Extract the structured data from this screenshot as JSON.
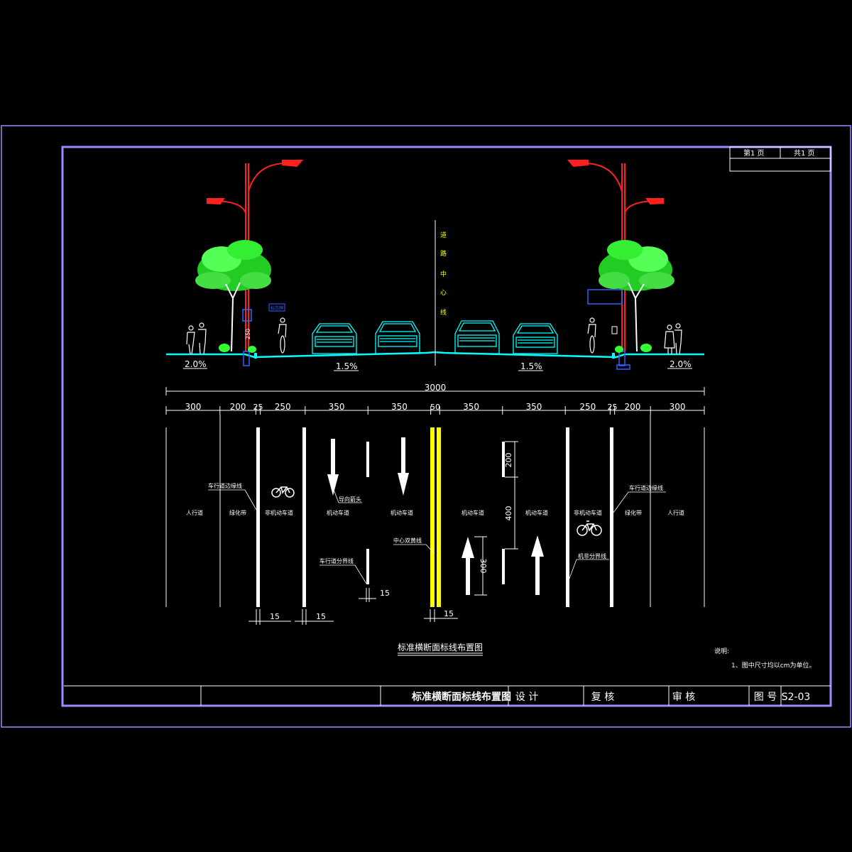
{
  "sheet": {
    "page_no": "第1 页",
    "page_total": "共1 页"
  },
  "section": {
    "centerline_chars": [
      "道",
      "路",
      "中",
      "心",
      "线"
    ],
    "slopes": {
      "left_walk": "2.0%",
      "left_road": "1.5%",
      "right_road": "1.5%",
      "right_walk": "2.0%"
    },
    "sign_text": "标志牌",
    "pole_dim": "250"
  },
  "dims": {
    "total": "3000",
    "segments": [
      "300",
      "200",
      "25",
      "250",
      "350",
      "350",
      "50",
      "350",
      "350",
      "250",
      "25",
      "200",
      "300"
    ],
    "arrow_len": "300",
    "dash_len": "200",
    "gap_len": "400",
    "w15_a": "15",
    "w15_b": "15",
    "w15_c": "15",
    "w15_d": "15"
  },
  "labels": {
    "sidewalk_l": "人行道",
    "green_l": "绿化带",
    "nonmotor_l": "非机动车道",
    "motor1": "机动车道",
    "motor2": "机动车道",
    "motor3": "机动车道",
    "motor4": "机动车道",
    "nonmotor_r": "非机动车道",
    "green_r": "绿化带",
    "sidewalk_r": "人行道",
    "edge_line_l": "车行道边缘线",
    "edge_line_r": "车行道边缘线",
    "guide_arrow": "导向箭头",
    "lane_divider": "车行道分界线",
    "center_double_yellow": "中心双黄线",
    "motor_nonmotor_line": "机非分界线"
  },
  "drawing_title": "标准横断面标线布置图",
  "notes": {
    "title": "说明:",
    "item1": "1、图中尺寸均以cm为单位。"
  },
  "titleblock": {
    "name": "标准横断面标线布置图",
    "design": "设 计",
    "check": "复 核",
    "review": "审 核",
    "figno_label": "图 号",
    "figno": "S2-03"
  },
  "colors": {
    "frame": "#9b8cff",
    "road": "#00ffff",
    "lane": "#ffffff",
    "center": "#ffff00",
    "pole": "#ff2020",
    "tree": "#33ff33"
  }
}
